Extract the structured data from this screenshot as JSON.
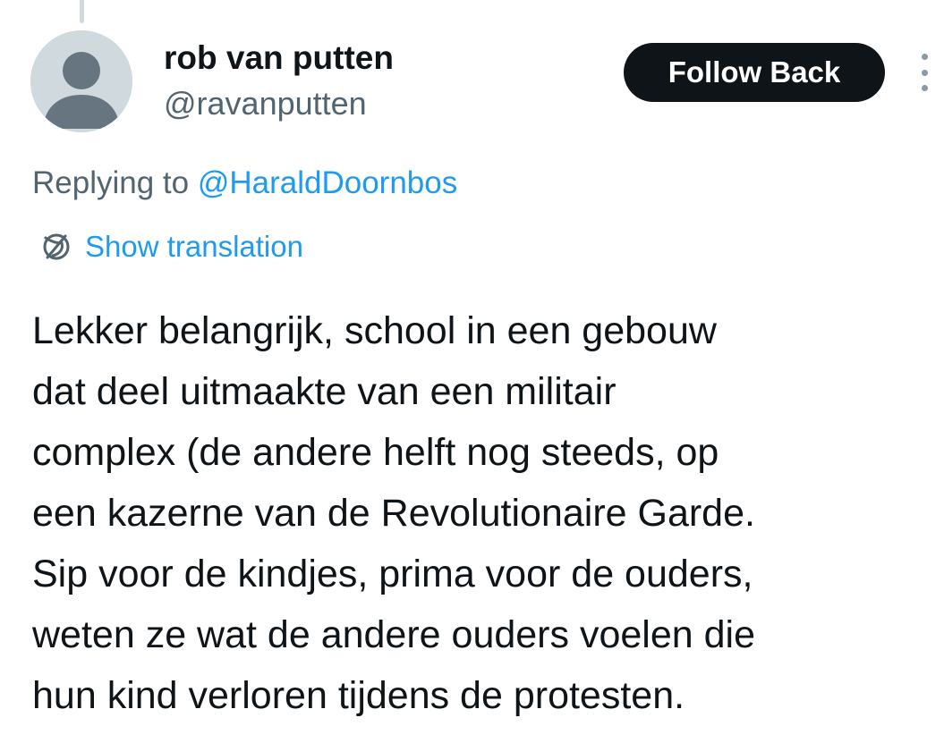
{
  "author": {
    "display_name": "rob van putten",
    "handle": "@ravanputten",
    "avatar_icon": "default-profile-icon"
  },
  "actions": {
    "follow_label": "Follow Back",
    "more_icon": "more-vertical-icon"
  },
  "reply": {
    "prefix": "Replying to",
    "mention": "@HaraldDoornbos"
  },
  "translation": {
    "icon": "globe-translate-icon",
    "label": "Show translation"
  },
  "tweet": {
    "lines": [
      "Lekker belangrijk, school in een gebouw",
      "dat deel uitmaakte van een militair",
      "complex (de andere helft nog steeds, op",
      "een kazerne van de Revolutionaire Garde.",
      "Sip voor de kindjes, prima voor de ouders,",
      "weten ze wat de andere ouders voelen die",
      "hun kind verloren tijdens de protesten."
    ]
  },
  "colors": {
    "text": "#0f1419",
    "secondary": "#536471",
    "accent": "#1d9bf0",
    "button_bg": "#0f1419",
    "avatar_bg": "#cfd9de",
    "avatar_fg": "#66757f"
  }
}
